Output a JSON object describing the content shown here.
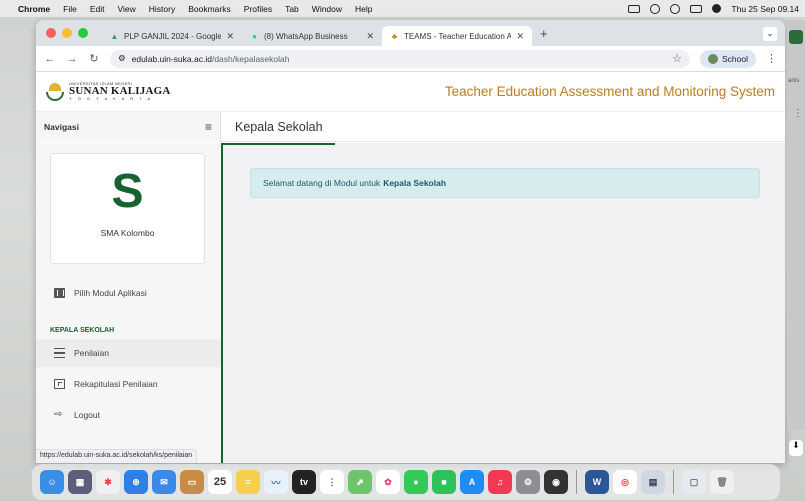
{
  "menubar": {
    "apple": "",
    "items": [
      "Chrome",
      "File",
      "Edit",
      "View",
      "History",
      "Bookmarks",
      "Profiles",
      "Tab",
      "Window",
      "Help"
    ],
    "clock": "Thu 25 Sep 09.14"
  },
  "tabs": [
    {
      "title": "PLP GANJIL 2024 - Google D",
      "icon": "google-drive-icon"
    },
    {
      "title": "(8) WhatsApp Business",
      "icon": "whatsapp-icon"
    },
    {
      "title": "TEAMS - Teacher Education A",
      "icon": "teams-site-icon"
    }
  ],
  "toolbar": {
    "url_host": "edulab.uin-suka.ac.id",
    "url_path": "/dash/kepalasekolah",
    "profile_label": "School"
  },
  "header": {
    "logo_line1": "UNIVERSITAS ISLAM NEGERI",
    "logo_line2": "SUNAN KALIJAGA",
    "logo_line3": "Y O G Y A K A R T A",
    "system_title": "Teacher Education Assessment and Monitoring System"
  },
  "sidebar": {
    "heading": "Navigasi",
    "profile_initial": "S",
    "profile_name": "SMA Kolombo",
    "module_item": "Pilih Modul Aplikasi",
    "section_label": "KEPALA SEKOLAH",
    "items": [
      {
        "label": "Penilaian",
        "icon": "list-icon",
        "active": true
      },
      {
        "label": "Rekapitulasi Penilaian",
        "icon": "table-icon",
        "active": false
      },
      {
        "label": "Logout",
        "icon": "logout-icon",
        "active": false
      }
    ]
  },
  "main": {
    "page_title": "Kepala Sekolah",
    "welcome_text": "Selamat datang di Modul untuk",
    "welcome_bold": "Kepala Sekolah"
  },
  "status_url": "https://edulab.uin-suka.ac.id/sekolah/ks/penilaian",
  "edge": {
    "text": "arks"
  },
  "colors": {
    "brand_green": "#17622f",
    "title_gold": "#b8801f",
    "alert_bg": "#d6ecef"
  },
  "dock": [
    "finder-icon",
    "launchpad-icon",
    "safari-icon",
    "mail-icon",
    "photos-icon",
    "calendar-icon",
    "notes-icon",
    "freeform-icon",
    "tv-icon",
    "reminders-icon",
    "maps-icon",
    "photos-app-icon",
    "messages-icon",
    "facetime-icon",
    "app-store-icon",
    "music-icon",
    "settings-icon",
    "github-icon",
    "word-icon",
    "chrome-icon",
    "preview-icon",
    "files-icon",
    "trash-icon"
  ],
  "dock_calendar_day": "25"
}
